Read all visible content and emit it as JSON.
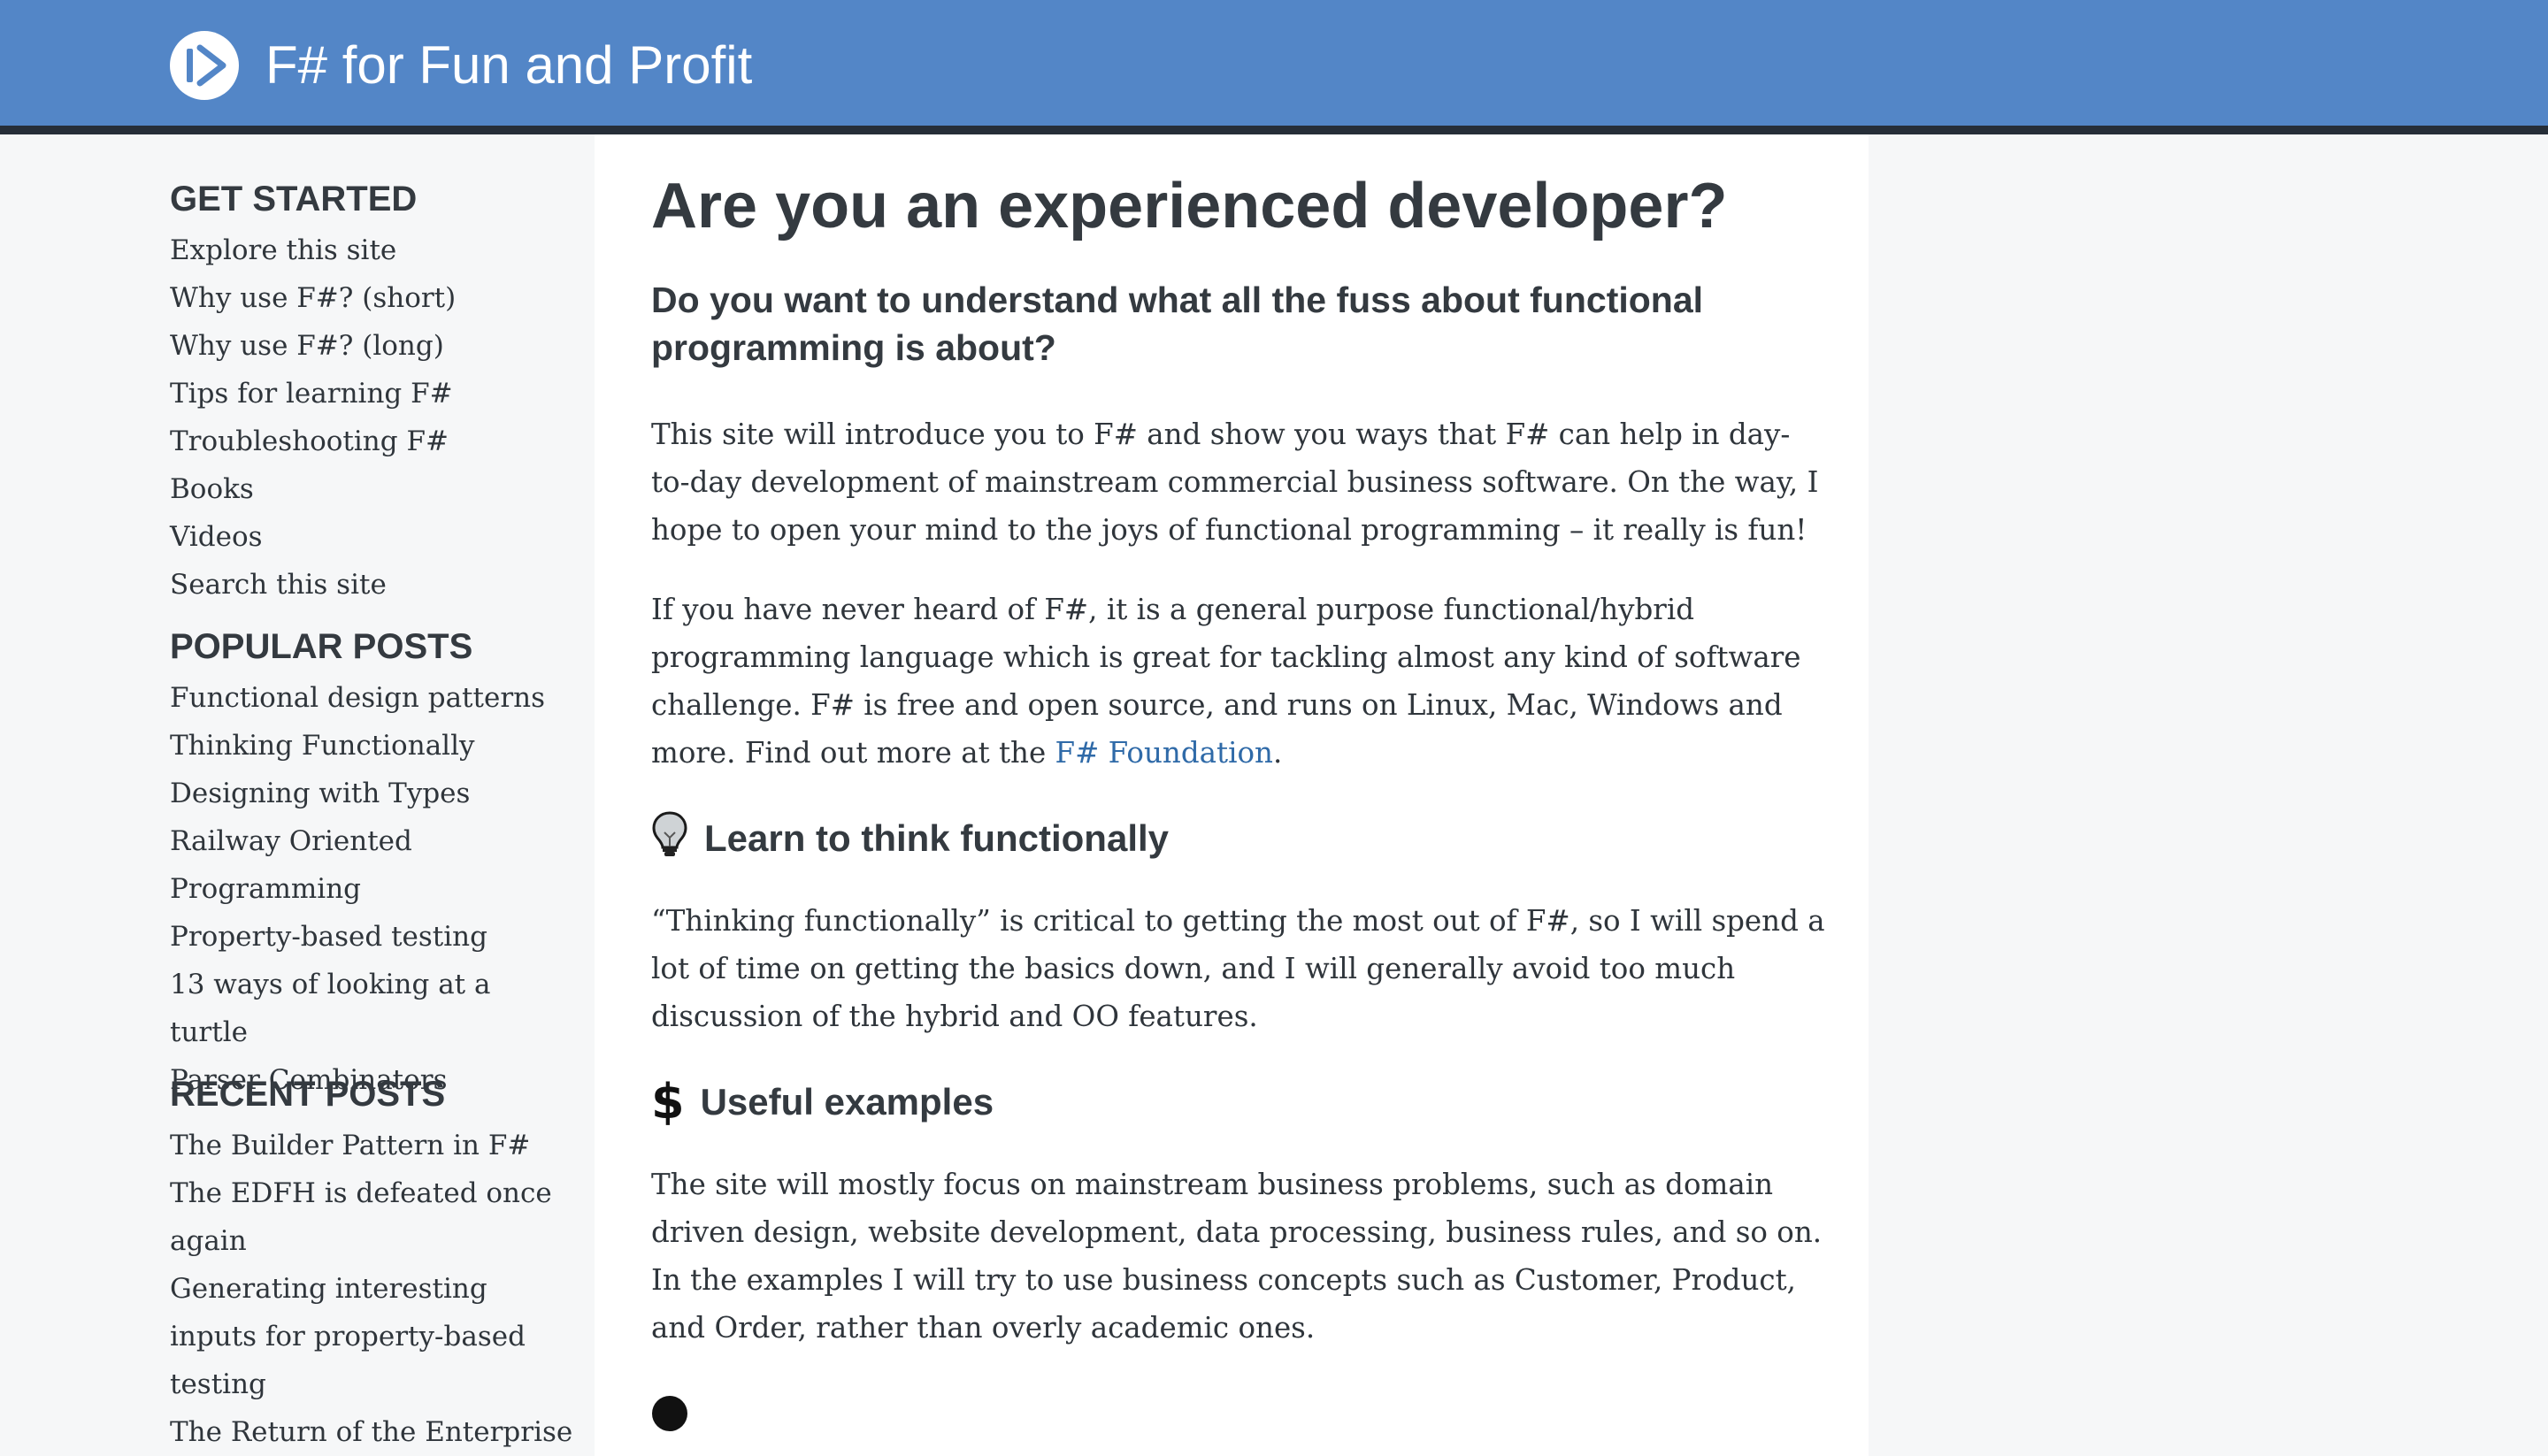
{
  "header": {
    "site_title": "F# for Fun and Profit"
  },
  "sidebar": {
    "get_started": {
      "title": "GET STARTED",
      "items": [
        "Explore this site",
        "Why use F#? (short)",
        "Why use F#? (long)",
        "Tips for learning F#",
        "Troubleshooting F#",
        "Books",
        "Videos",
        "Search this site"
      ]
    },
    "popular_posts": {
      "title": "POPULAR POSTS",
      "items": [
        "Functional design patterns",
        "Thinking Functionally",
        "Designing with Types",
        "Railway Oriented Programming",
        "Property-based testing",
        "13 ways of looking at a turtle",
        "Parser Combinators"
      ]
    },
    "recent_posts": {
      "title": "RECENT POSTS",
      "items": [
        "The Builder Pattern in F#",
        "The EDFH is defeated once again",
        "Generating interesting inputs for property-based testing",
        "The Return of the Enterprise"
      ]
    }
  },
  "main": {
    "title": "Are you an experienced developer?",
    "subtitle": "Do you want to understand what all the fuss about functional programming is about?",
    "intro": "This site will introduce you to F# and show you ways that F# can help in day-to-day development of mainstream commercial business software. On the way, I hope to open your mind to the joys of functional programming – it really is fun!",
    "fsharp_para_before": "If you have never heard of F#, it is a general purpose functional/hybrid programming language which is great for tackling almost any kind of software challenge. F# is free and open source, and runs on Linux, Mac, Windows and more. Find out more at the ",
    "fsharp_link": "F# Foundation",
    "fsharp_para_after": ".",
    "sections": [
      {
        "icon": "lightbulb-icon",
        "heading": "Learn to think functionally",
        "text": "“Thinking functionally” is critical to getting the most out of F#, so I will spend a lot of time on getting the basics down, and I will generally avoid too much discussion of the hybrid and OO features."
      },
      {
        "icon": "dollar-icon",
        "heading": "Useful examples",
        "text": "The site will mostly focus on mainstream business problems, such as domain driven design, website development, data processing, business rules, and so on. In the examples I will try to use business concepts such as Customer, Product, and Order, rather than overly academic ones."
      }
    ]
  },
  "colors": {
    "header_bg": "#5386c7",
    "header_border": "#262e38",
    "sidebar_bg": "#f6f7f8",
    "content_bg": "#ffffff",
    "text": "#2f353b",
    "heading": "#343a40",
    "link": "#2f6aa8"
  }
}
